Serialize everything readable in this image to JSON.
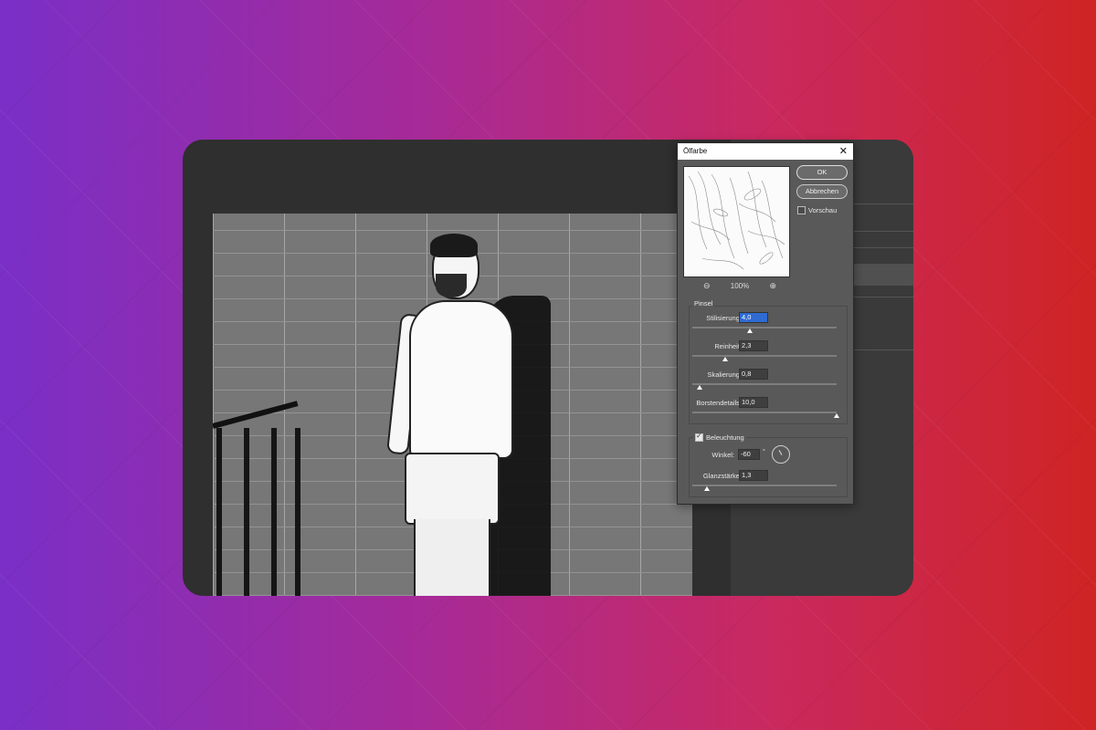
{
  "dialog": {
    "title": "Ölfarbe",
    "close_glyph": "✕",
    "ok_label": "OK",
    "cancel_label": "Abbrechen",
    "preview_label": "Vorschau",
    "preview_checked": false,
    "zoom_level": "100%",
    "zoom_out_glyph": "⊖",
    "zoom_in_glyph": "⊕",
    "brush_group_title": "Pinsel",
    "params": [
      {
        "label": "Stilisierung:",
        "value": "4,0",
        "slider_fraction": 0.4
      },
      {
        "label": "Reinheit:",
        "value": "2,3",
        "slider_fraction": 0.23
      },
      {
        "label": "Skalierung:",
        "value": "0,8",
        "slider_fraction": 0.05
      },
      {
        "label": "Borstendetails:",
        "value": "10,0",
        "slider_fraction": 1.0
      }
    ],
    "lighting_label": "Beleuchtung",
    "lighting_checked": true,
    "angle_label": "Winkel:",
    "angle_value": "-60",
    "angle_unit": "°",
    "gloss_label": "Glanzstärke:",
    "gloss_value": "1,3",
    "gloss_slider_fraction": 0.1
  }
}
